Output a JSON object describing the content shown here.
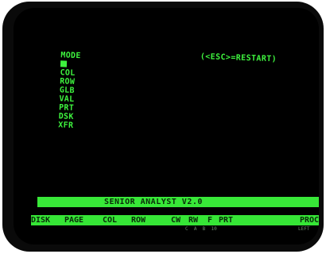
{
  "menu": {
    "mode_label": "MODE",
    "items": [
      "COL",
      "ROW",
      "GLB",
      "VAL",
      "PRT",
      "DSK",
      "XFR"
    ],
    "restart_hint": "(<ESC>=RESTART)"
  },
  "title_bar": {
    "text": "SENIOR ANALYST V2.0"
  },
  "command_bar": {
    "items": [
      "DISK",
      "PAGE",
      "COL",
      "ROW",
      "CW",
      "RW",
      "F",
      "PRT",
      "PROC"
    ]
  },
  "sub_line": {
    "left": "C  A  B  10",
    "right": "LEFT"
  },
  "colors": {
    "phosphor": "#3ef23e",
    "screen": "#000000",
    "bezel": "#0a0a0a"
  }
}
